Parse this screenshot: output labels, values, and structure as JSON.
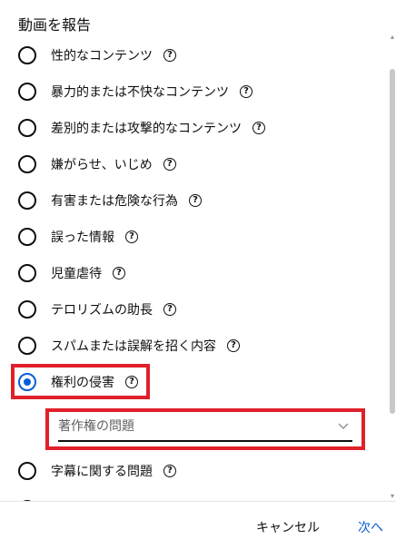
{
  "dialog": {
    "title": "動画を報告",
    "options": [
      {
        "label": "性的なコンテンツ",
        "checked": false
      },
      {
        "label": "暴力的または不快なコンテンツ",
        "checked": false
      },
      {
        "label": "差別的または攻撃的なコンテンツ",
        "checked": false
      },
      {
        "label": "嫌がらせ、いじめ",
        "checked": false
      },
      {
        "label": "有害または危険な行為",
        "checked": false
      },
      {
        "label": "誤った情報",
        "checked": false
      },
      {
        "label": "児童虐待",
        "checked": false
      },
      {
        "label": "テロリズムの助長",
        "checked": false
      },
      {
        "label": "スパムまたは誤解を招く内容",
        "checked": false
      },
      {
        "label": "権利の侵害",
        "checked": true
      },
      {
        "label": "字幕に関する問題",
        "checked": false
      }
    ],
    "help_glyph": "?",
    "subreason": {
      "value": "著作権の問題"
    },
    "cancel_label": "キャンセル",
    "next_label": "次へ"
  },
  "icons": [
    "radio-icon",
    "help-icon",
    "chevron-down-icon"
  ],
  "colors": {
    "accent": "#065fd4",
    "highlight": "#e0202a",
    "text": "#0f0f0f",
    "muted": "#606060"
  }
}
